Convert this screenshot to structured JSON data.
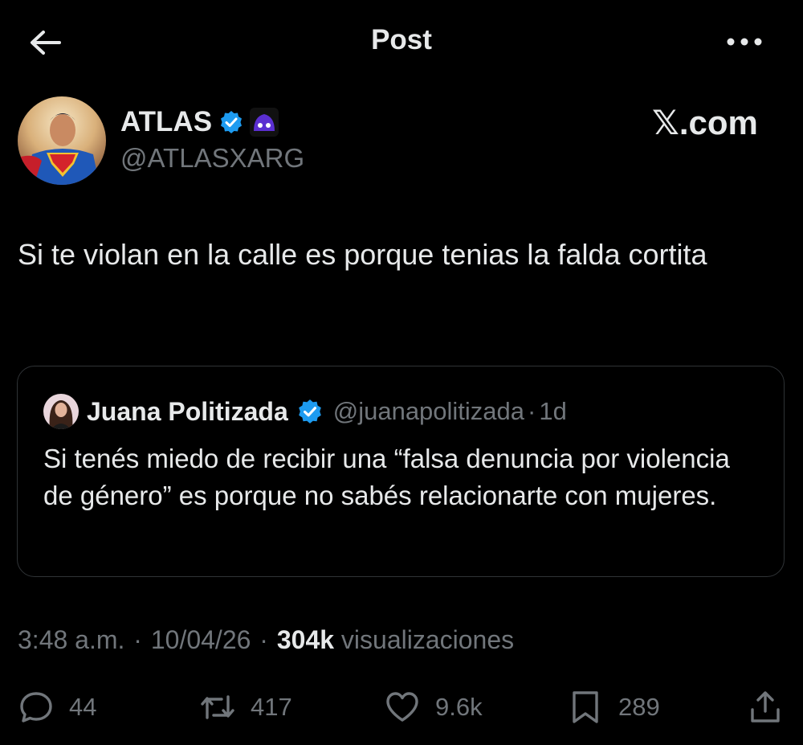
{
  "header": {
    "title": "Post",
    "back_icon": "arrow-left-icon",
    "more_icon": "more-horizontal-icon"
  },
  "post": {
    "author_name": "ATLAS",
    "author_handle": "@ATLASXARG",
    "watermark": "𝕏.com",
    "text": "Si te violan en la calle es porque tenias la falda cortita",
    "verified_color": "#1d9bf0",
    "affiliation_badge_color": "#5b2fd1"
  },
  "quoted": {
    "name": "Juana Politizada",
    "handle": "@juanapolitizada",
    "separator": "·",
    "time": "1d",
    "text": "Si tenés miedo de recibir una “falsa denuncia por violencia de género” es porque no sabés relacionarte con mujeres."
  },
  "meta": {
    "time": "3:48 a.m.",
    "sep1": "·",
    "date": "10/04/26",
    "sep2": "·",
    "views_count": "304k",
    "views_label": "visualizaciones"
  },
  "actions": {
    "replies": "44",
    "reposts": "417",
    "likes": "9.6k",
    "bookmarks": "289"
  }
}
